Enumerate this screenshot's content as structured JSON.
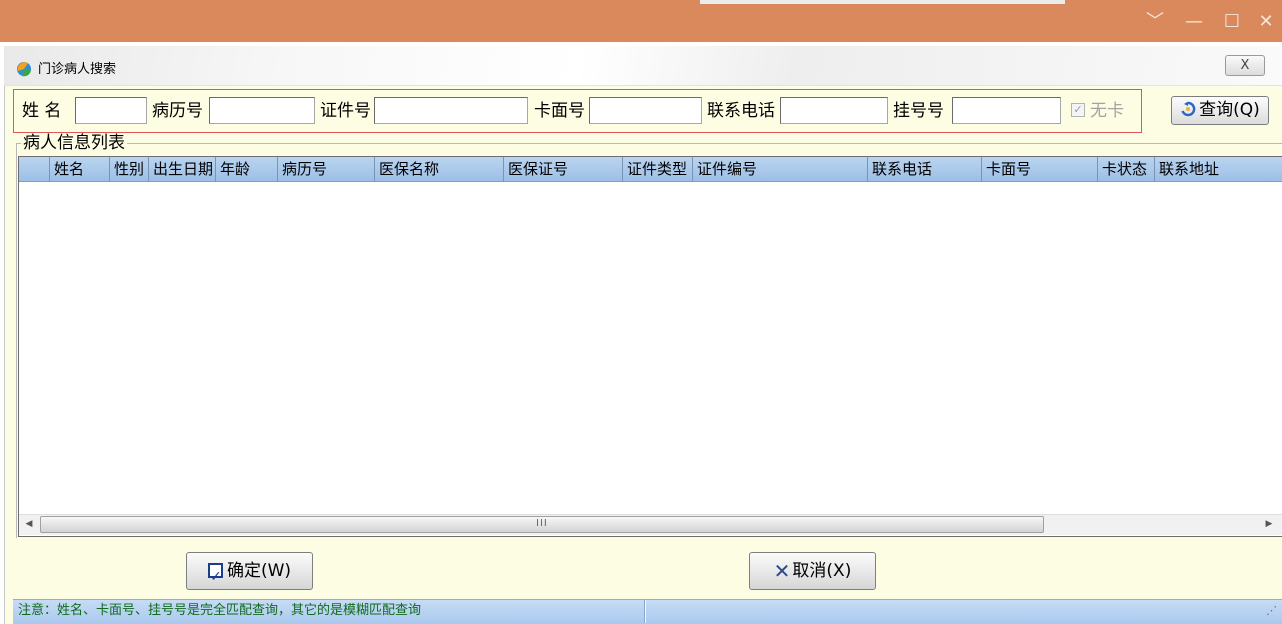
{
  "window": {
    "controls": [
      "﹀",
      "—",
      "☐",
      "✕"
    ]
  },
  "dialog": {
    "title": "门诊病人搜索",
    "close_glyph": "X",
    "icon": "app-logo-icon"
  },
  "search": {
    "fields": [
      {
        "label": "姓 名",
        "value": ""
      },
      {
        "label": "病历号",
        "value": ""
      },
      {
        "label": "证件号",
        "value": ""
      },
      {
        "label": "卡面号",
        "value": ""
      },
      {
        "label": "联系电话",
        "value": ""
      },
      {
        "label": "挂号号",
        "value": ""
      }
    ],
    "nocard_label": "无卡",
    "nocard_checked": true,
    "query_label": "查询(Q)"
  },
  "list": {
    "group_title": "病人信息列表",
    "columns": [
      "姓名",
      "性别",
      "出生日期",
      "年龄",
      "病历号",
      "医保名称",
      "医保证号",
      "证件类型",
      "证件编号",
      "联系电话",
      "卡面号",
      "卡状态",
      "联系地址"
    ],
    "rows": [],
    "scroll_grip": "III"
  },
  "buttons": {
    "confirm": "确定(W)",
    "cancel": "取消(X)"
  },
  "status": {
    "message": "注意：姓名、卡面号、挂号号是完全匹配查询，其它的是模糊匹配查询"
  },
  "colors": {
    "titlebar": "#d9895b",
    "dialog_bg": "#fdfde3",
    "grid_header": "#aac8ec",
    "status_text": "#0f6a1e",
    "search_border": "#e05656"
  }
}
